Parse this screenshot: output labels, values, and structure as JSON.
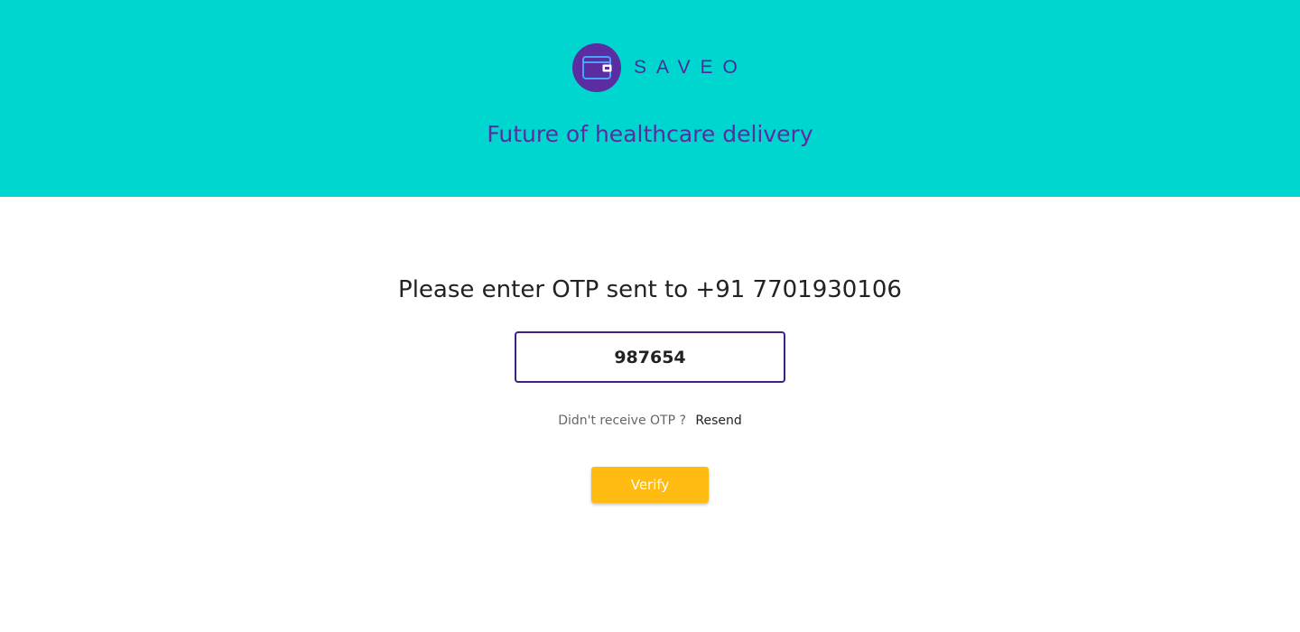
{
  "header": {
    "brand_name": "SAVEO",
    "logo_icon": "wallet-icon",
    "tagline": "Future of healthcare delivery"
  },
  "otp": {
    "prompt": "Please enter OTP sent to +91 7701930106",
    "value": "987654",
    "resend_question": "Didn't receive OTP ?",
    "resend_label": "Resend",
    "verify_label": "Verify"
  },
  "colors": {
    "header_bg": "#00d6d0",
    "brand_purple": "#5a2da0",
    "input_border": "#3d2280",
    "button_bg": "#ffbb12"
  }
}
